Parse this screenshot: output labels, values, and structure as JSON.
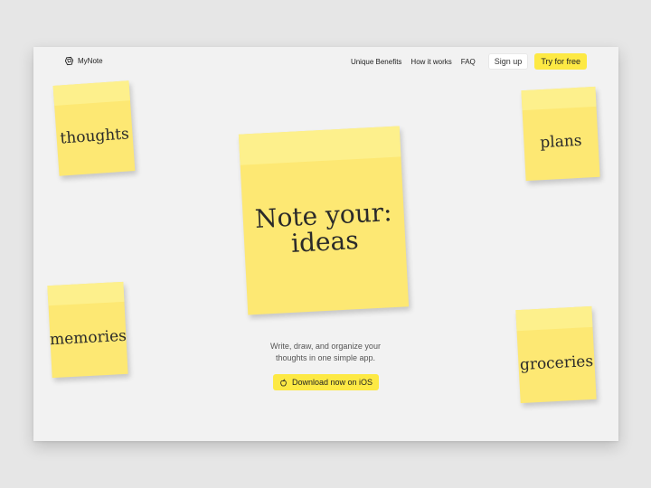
{
  "brand": {
    "name": "MyNote",
    "icon": "logo-icon"
  },
  "nav": {
    "links": [
      "Unique Benefits",
      "How it works",
      "FAQ"
    ],
    "signup_label": "Sign up",
    "try_label": "Try for free"
  },
  "notes": {
    "thoughts": "thoughts",
    "plans": "plans",
    "memories": "memories",
    "groceries": "groceries"
  },
  "hero": {
    "line1": "Note your:",
    "line2": "ideas",
    "tagline_line1": "Write, draw, and organize your",
    "tagline_line2": "thoughts in one simple app.",
    "download_label": "Download now on iOS",
    "download_icon": "apple-icon"
  },
  "colors": {
    "accent": "#fde944",
    "note": "#fde873",
    "note_header": "#fdf08c",
    "background": "#f2f2f2"
  }
}
